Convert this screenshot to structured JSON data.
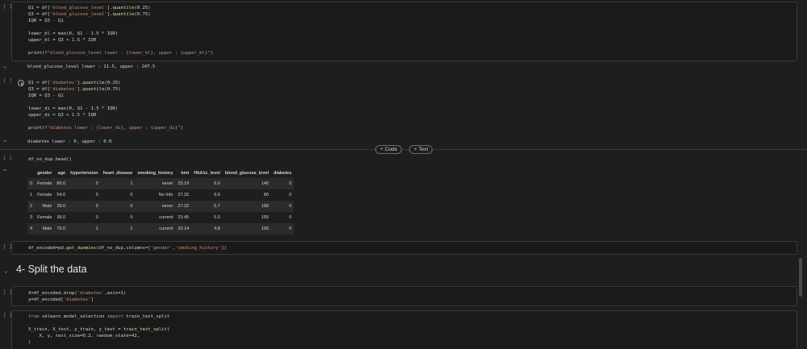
{
  "cells": {
    "c1": {
      "gutter": "[ ]",
      "lines": [
        "Q1 = df['blood_glucose_level'].quantile(0.25)",
        "Q3 = df['blood_glucose_level'].quantile(0.75)",
        "IQR = Q3 - Q1",
        "",
        "lower_bl = max(0, Q1 - 1.5 * IQR)",
        "upper_bl = Q3 + 1.5 * IQR",
        "",
        "print(f\"blood_glucose_level lower : {lower_bl}, upper : {upper_bl}\")"
      ],
      "output": "blood_glucose_level lower : 11.5, upper : 247.5"
    },
    "c2": {
      "gutter": "[ ]",
      "lines": [
        "Q1 = df['diabetes'].quantile(0.25)",
        "Q3 = df['diabetes'].quantile(0.75)",
        "IQR = Q3 - Q1",
        "",
        "lower_di = max(0, Q1 - 1.5 * IQR)",
        "upper_di = Q3 + 1.5 * IQR",
        "",
        "print(f\"diabetes lower : {lower_di}, upper : {upper_di}\")"
      ],
      "output": "diabetes lower : 0, upper : 0.0"
    },
    "c3": {
      "gutter": "[ ]",
      "code": "df_no_dup.head()"
    },
    "c4": {
      "gutter": "[ ]",
      "code": "df_encoded=pd.get_dummies(df_no_dup,columns=['gender','smoking_history'])"
    },
    "c5": {
      "gutter": "[ ]",
      "lines": [
        "X=df_encoded.drop('diabetes',axis=1)",
        "y=df_encoded['diabetes']"
      ]
    },
    "c6": {
      "gutter": "[ ]",
      "lines": [
        "from sklearn.model_selection import train_test_split",
        "",
        "X_train, X_test, y_train, y_test = train_test_split(",
        "    X, y, test_size=0.2, random_state=42,",
        ")"
      ]
    }
  },
  "add_buttons": {
    "code": "+ Code",
    "text": "+ Text"
  },
  "table": {
    "headers": [
      "",
      "gender",
      "age",
      "hypertension",
      "heart_disease",
      "smoking_history",
      "bmi",
      "HbA1c_level",
      "blood_glucose_level",
      "diabetes"
    ],
    "rows": [
      [
        "0",
        "Female",
        "80.0",
        "0",
        "1",
        "never",
        "25.19",
        "6.6",
        "140",
        "0"
      ],
      [
        "1",
        "Female",
        "54.0",
        "0",
        "0",
        "No Info",
        "27.32",
        "6.6",
        "80",
        "0"
      ],
      [
        "2",
        "Male",
        "28.0",
        "0",
        "0",
        "never",
        "27.32",
        "5.7",
        "158",
        "0"
      ],
      [
        "3",
        "Female",
        "36.0",
        "0",
        "0",
        "current",
        "23.45",
        "5.0",
        "155",
        "0"
      ],
      [
        "4",
        "Male",
        "76.0",
        "1",
        "1",
        "current",
        "20.14",
        "4.8",
        "155",
        "0"
      ]
    ]
  },
  "section": {
    "title": "4- Split the data"
  }
}
